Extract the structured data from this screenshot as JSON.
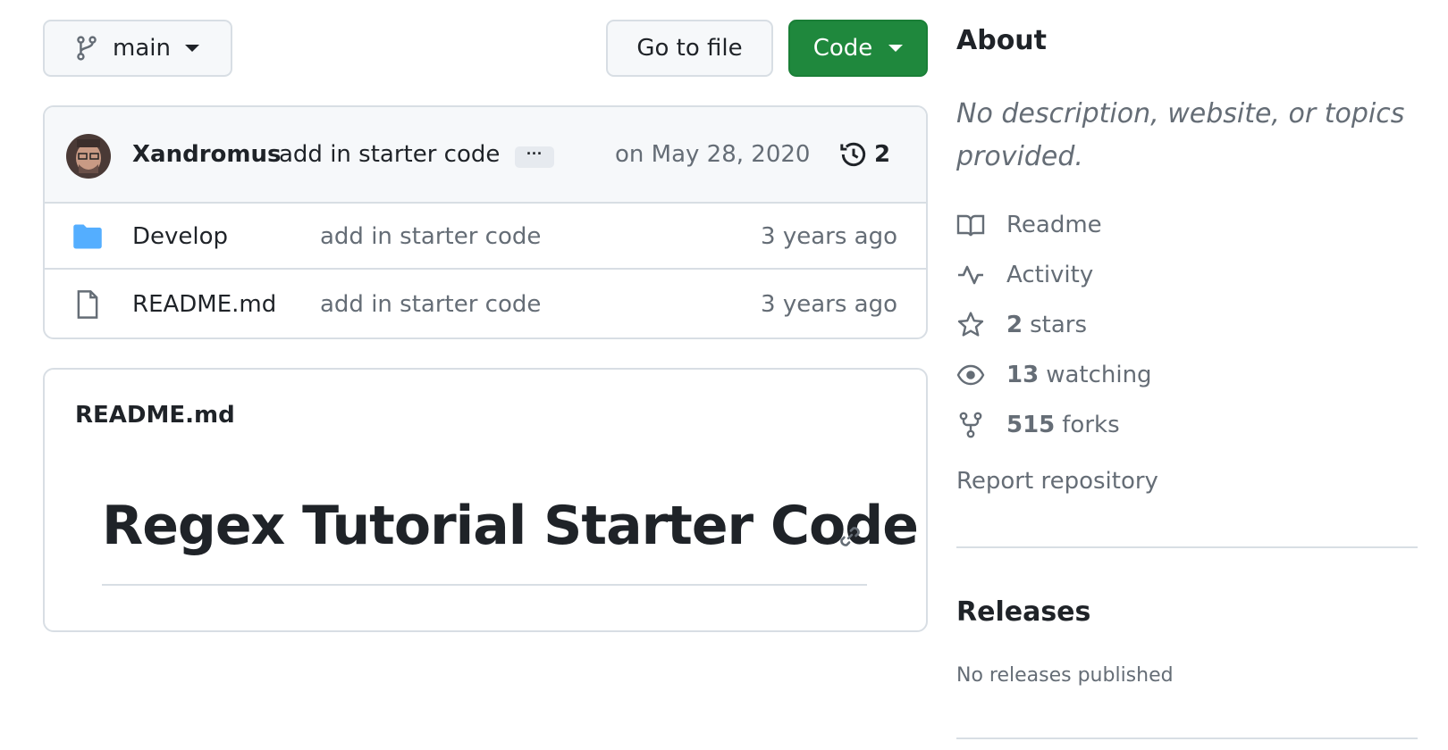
{
  "toolbar": {
    "branch_label": "main",
    "go_to_file_label": "Go to file",
    "code_label": "Code",
    "code_button_color": "#1f883d"
  },
  "commit": {
    "author": "Xandromus",
    "message": "add in starter code",
    "ellipsis": "···",
    "date": "on May 28, 2020",
    "history_count": "2"
  },
  "files": [
    {
      "icon": "folder-icon",
      "name": "Develop",
      "message": "add in starter code",
      "age": "3 years ago"
    },
    {
      "icon": "file-icon",
      "name": "README.md",
      "message": "add in starter code",
      "age": "3 years ago"
    }
  ],
  "readme": {
    "label": "README.md",
    "title": "Regex Tutorial Starter Code"
  },
  "about": {
    "title": "About",
    "description": "No description, website, or topics provided.",
    "readme_label": "Readme",
    "activity_label": "Activity",
    "stars_count": "2",
    "stars_label": "stars",
    "watching_count": "13",
    "watching_label": "watching",
    "forks_count": "515",
    "forks_label": "forks",
    "report_label": "Report repository"
  },
  "releases": {
    "title": "Releases",
    "empty_text": "No releases published"
  }
}
